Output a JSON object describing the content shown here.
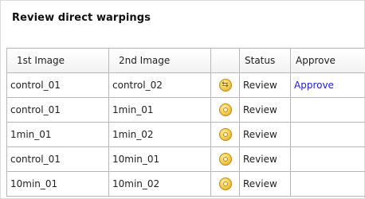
{
  "panel": {
    "title": "Review direct warpings"
  },
  "table": {
    "headers": {
      "first_image": "1st Image",
      "second_image": "2nd Image",
      "icon": "",
      "status": "Status",
      "approve": "Approve"
    },
    "rows": [
      {
        "first": "control_01",
        "second": "control_02",
        "icon": "arrows-icon",
        "status": "Review",
        "approve": "Approve"
      },
      {
        "first": "control_01",
        "second": "1min_01",
        "icon": "gear-icon",
        "status": "Review",
        "approve": ""
      },
      {
        "first": "1min_01",
        "second": "1min_02",
        "icon": "gear-icon",
        "status": "Review",
        "approve": ""
      },
      {
        "first": "control_01",
        "second": "10min_01",
        "icon": "gear-icon",
        "status": "Review",
        "approve": ""
      },
      {
        "first": "10min_01",
        "second": "10min_02",
        "icon": "gear-icon",
        "status": "Review",
        "approve": ""
      }
    ]
  },
  "colors": {
    "link": "#2020d0",
    "icon_fill": "#f5d25a",
    "border": "#b8b8b8"
  }
}
